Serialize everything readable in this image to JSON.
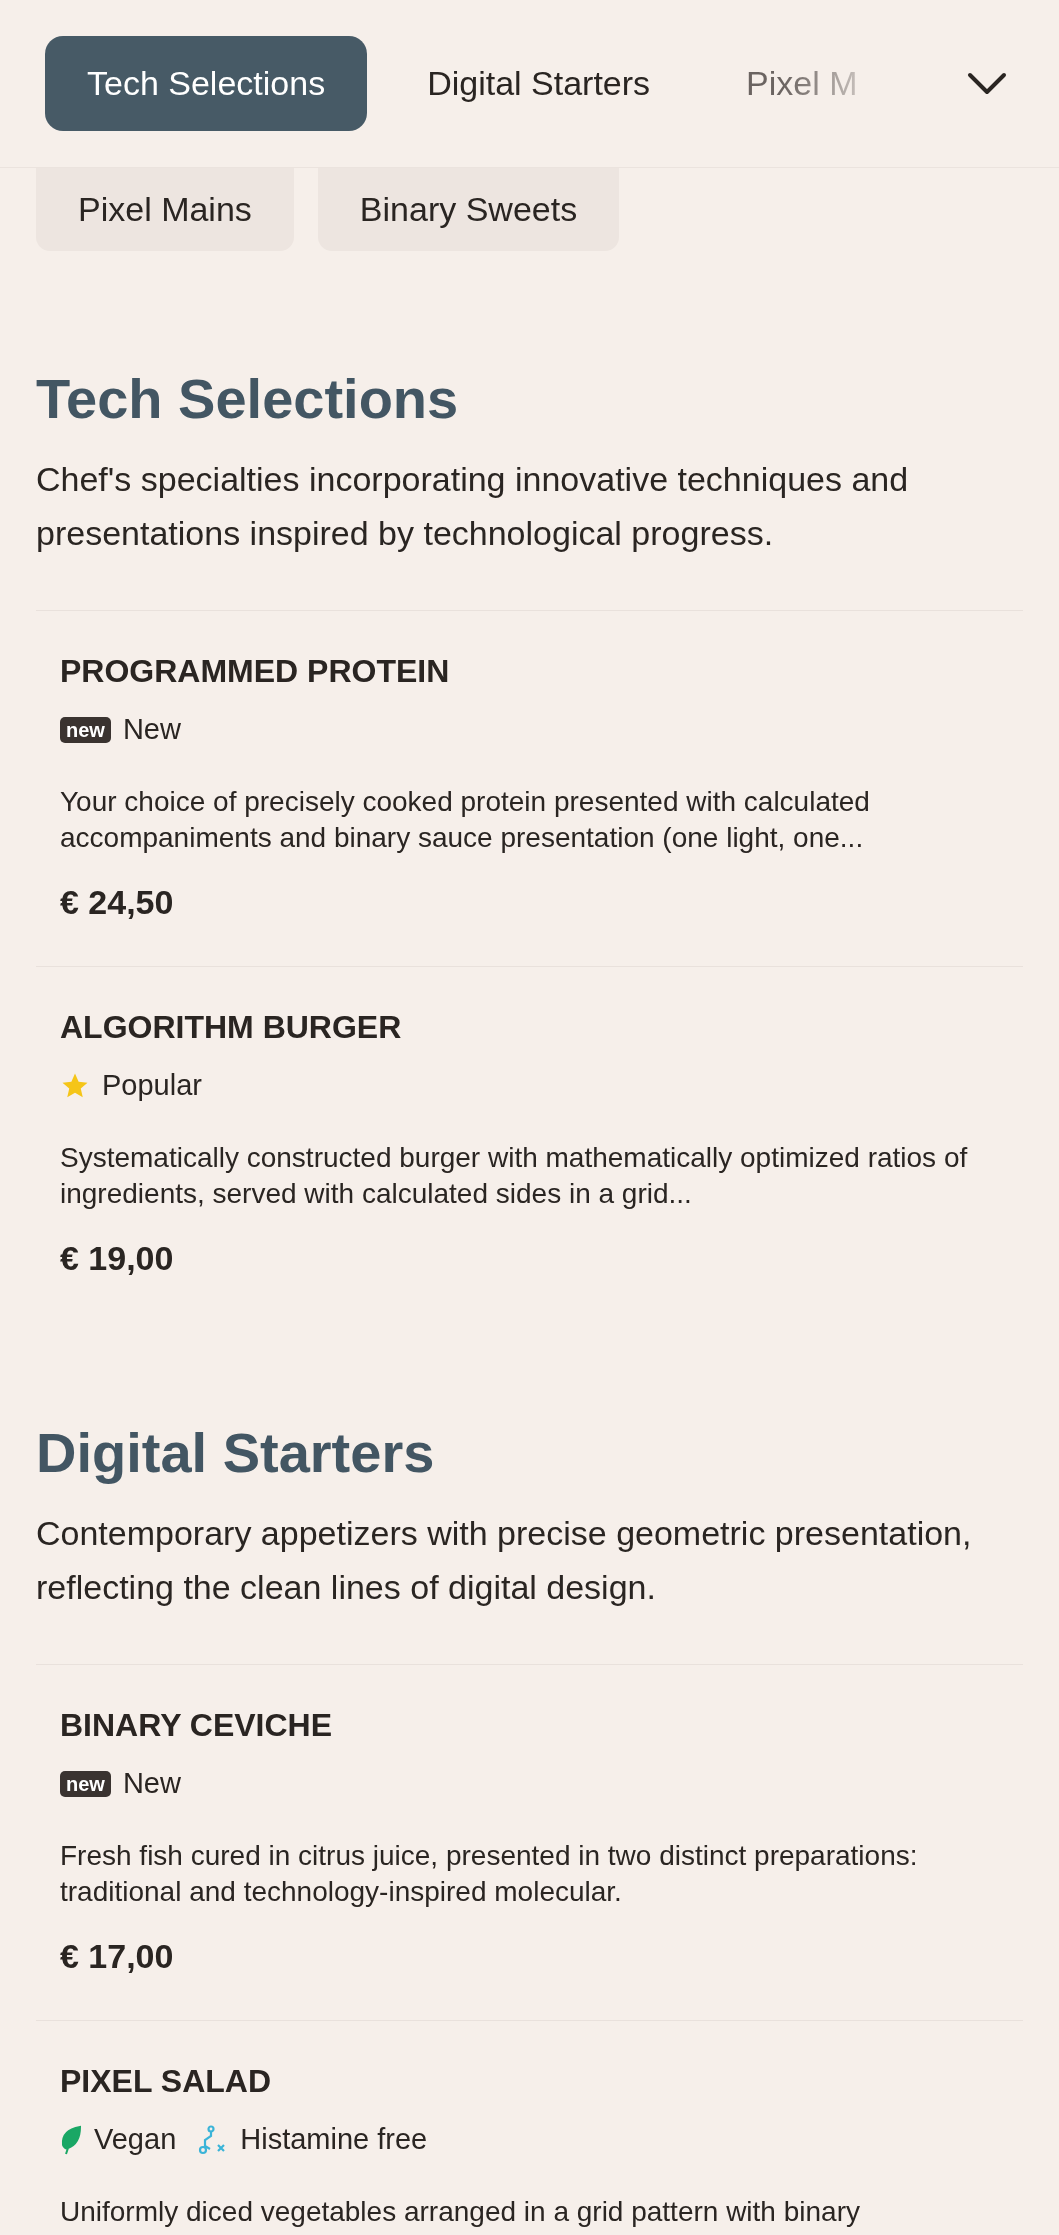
{
  "nav": {
    "tabs": [
      {
        "label": "Tech Selections",
        "selected": true
      },
      {
        "label": "Digital Starters",
        "selected": false
      },
      {
        "label": "Pixel M",
        "selected": false
      }
    ],
    "more_categories": [
      {
        "label": "Pixel Mains"
      },
      {
        "label": "Binary Sweets"
      }
    ]
  },
  "sections": [
    {
      "title": "Tech Selections",
      "description": "Chef's specialties incorporating innovative techniques and presentations inspired by technological progress.",
      "items": [
        {
          "name": "PROGRAMMED PROTEIN",
          "tags": [
            {
              "kind": "new",
              "badge": "new",
              "label": "New"
            }
          ],
          "description": "Your choice of precisely cooked protein presented with calculated accompaniments and binary sauce presentation (one light, one...",
          "price": "€ 24,50"
        },
        {
          "name": "ALGORITHM BURGER",
          "tags": [
            {
              "kind": "popular",
              "label": "Popular"
            }
          ],
          "description": "Systematically constructed burger with mathematically optimized ratios of ingredients, served with calculated sides in a grid...",
          "price": "€ 19,00"
        }
      ]
    },
    {
      "title": "Digital Starters",
      "description": "Contemporary appetizers with precise geometric presentation, reflecting the clean lines of digital design.",
      "items": [
        {
          "name": "BINARY CEVICHE",
          "tags": [
            {
              "kind": "new",
              "badge": "new",
              "label": "New"
            }
          ],
          "description": "Fresh fish cured in citrus juice, presented in two distinct preparations: traditional and technology-inspired molecular.",
          "price": "€ 17,00"
        },
        {
          "name": "PIXEL SALAD",
          "tags": [
            {
              "kind": "vegan",
              "label": "Vegan"
            },
            {
              "kind": "histamine_free",
              "label": "Histamine free"
            }
          ],
          "description": "Uniformly diced vegetables arranged in a grid pattern with binary"
        }
      ]
    }
  ]
}
